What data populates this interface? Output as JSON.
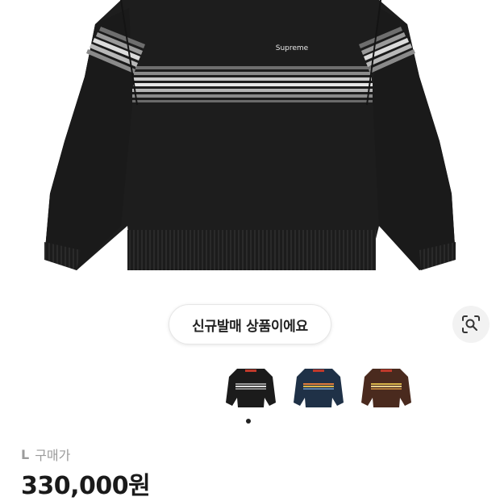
{
  "product": {
    "brand_mark": "Supreme",
    "badge_label": "신규발매 상품이에요",
    "size_label": "L",
    "purchase_label": "구매가",
    "price": "330,000원"
  },
  "variants": [
    {
      "color_name": "black",
      "body": "#1b1b1b"
    },
    {
      "color_name": "navy",
      "body": "#1f3147"
    },
    {
      "color_name": "brown",
      "body": "#4a2a1e"
    }
  ],
  "carousel": {
    "active_index": 0,
    "count": 1
  },
  "icons": {
    "lens": "image-search-icon"
  }
}
